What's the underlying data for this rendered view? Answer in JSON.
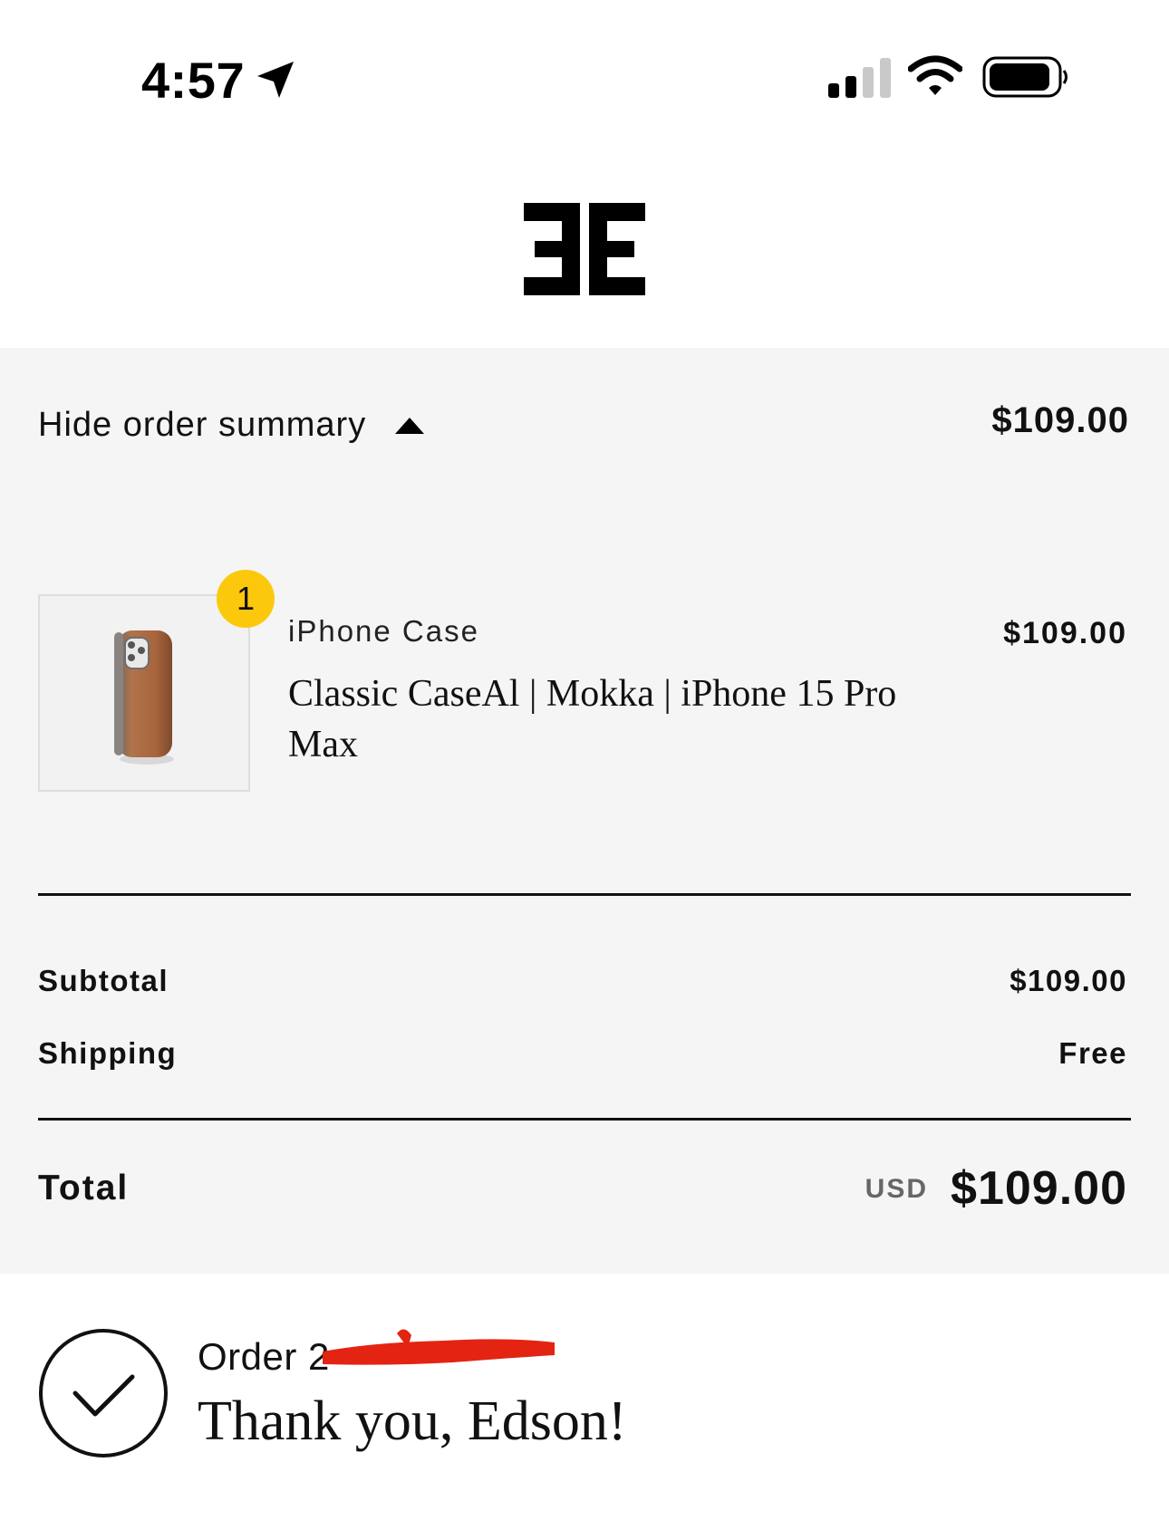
{
  "status_bar": {
    "time": "4:57",
    "icons": [
      "location-arrow-icon",
      "cellular-signal-icon",
      "wifi-icon",
      "battery-icon"
    ]
  },
  "header": {
    "logo": "brand-logo-icon"
  },
  "summary": {
    "toggle_label": "Hide order summary",
    "toggle_icon": "caret-up-icon",
    "total": "$109.00",
    "item": {
      "quantity": "1",
      "type": "iPhone Case",
      "name": "Classic CaseAl | Mokka | iPhone 15 Pro Max",
      "price": "$109.00",
      "image": "phone-case-thumbnail"
    },
    "subtotal_label": "Subtotal",
    "subtotal_value": "$109.00",
    "shipping_label": "Shipping",
    "shipping_value": "Free",
    "total_label": "Total",
    "currency": "USD",
    "grand_total": "$109.00"
  },
  "confirmation": {
    "order_label": "Order 2",
    "thank_you": "Thank you, Edson!",
    "icon": "checkmark-circle-icon"
  },
  "colors": {
    "panel_background": "#f5f5f5",
    "badge": "#fcc80c",
    "redaction": "#e32412",
    "text": "#111111"
  }
}
